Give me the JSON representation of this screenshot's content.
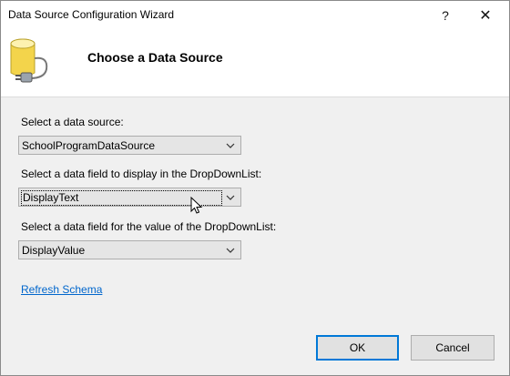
{
  "window": {
    "title": "Data Source Configuration Wizard",
    "help_glyph": "?",
    "close_glyph": "✕"
  },
  "header": {
    "title": "Choose a Data Source",
    "icon": "database-plug-icon"
  },
  "form": {
    "data_source_label": "Select a data source:",
    "data_source_value": "SchoolProgramDataSource",
    "display_field_label": "Select a data field to display in the DropDownList:",
    "display_field_value": "DisplayText",
    "value_field_label": "Select a data field for the value of the DropDownList:",
    "value_field_value": "DisplayValue",
    "refresh_link": "Refresh Schema"
  },
  "buttons": {
    "ok": "OK",
    "cancel": "Cancel"
  },
  "colors": {
    "accent": "#0078d7",
    "link": "#0066cc",
    "icon_yellow": "#f3d44b"
  }
}
